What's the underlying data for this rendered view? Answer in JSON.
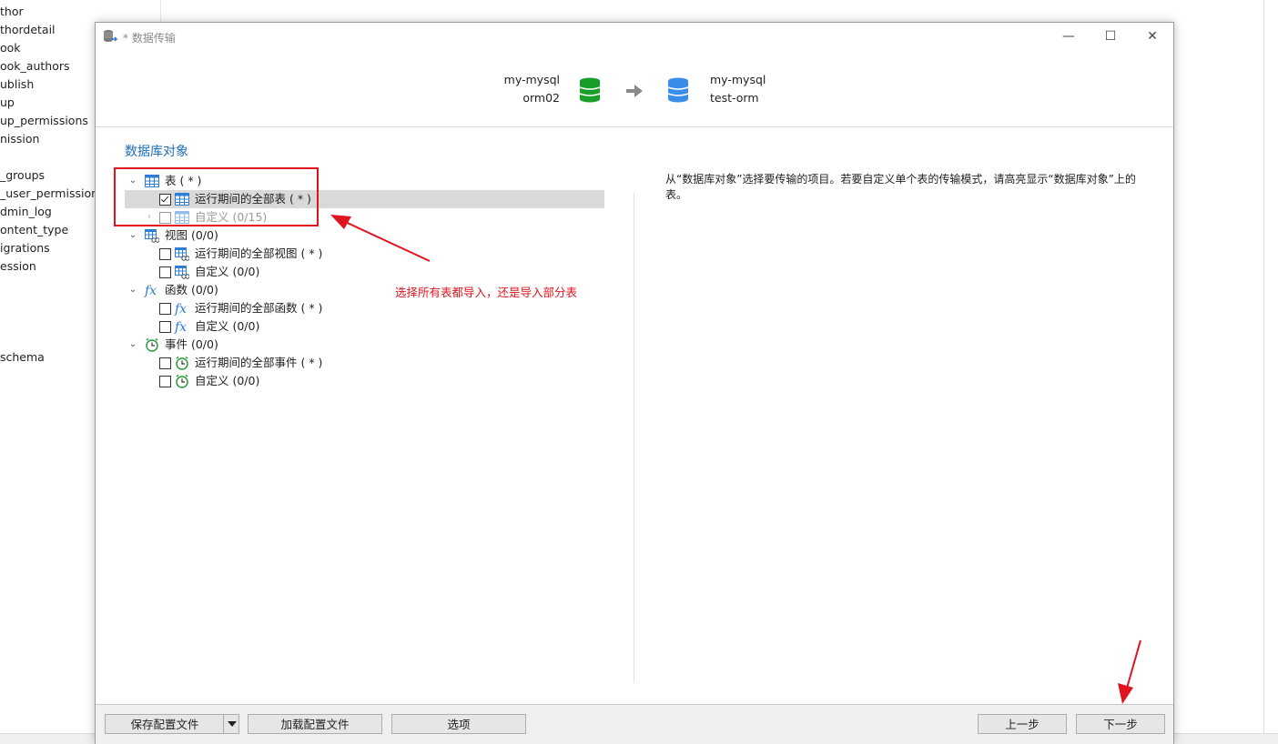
{
  "background": {
    "sidebar_items": [
      "thor",
      "thordetail",
      "ook",
      "ook_authors",
      "ublish",
      "up",
      "up_permissions",
      "nission",
      "_groups",
      "_user_permissions",
      "dmin_log",
      "ontent_type",
      "igrations",
      "ession",
      "schema"
    ]
  },
  "dialog": {
    "title": "* 数据传输",
    "window_controls": {
      "minimize": "—",
      "maximize": "☐",
      "close": "✕"
    },
    "source": {
      "connection": "my-mysql",
      "database": "orm02",
      "color": "#1a9e2a"
    },
    "target": {
      "connection": "my-mysql",
      "database": "test-orm",
      "color": "#3b8ee8"
    },
    "section_title": "数据库对象",
    "tree": {
      "tables": {
        "label": "表 ( * )",
        "all_runtime": "运行期间的全部表 ( * )",
        "custom": "自定义 (0/15)"
      },
      "views": {
        "label": "视图 (0/0)",
        "all_runtime": "运行期间的全部视图 ( * )",
        "custom": "自定义 (0/0)"
      },
      "functions": {
        "label": "函数 (0/0)",
        "all_runtime": "运行期间的全部函数 ( * )",
        "custom": "自定义 (0/0)"
      },
      "events": {
        "label": "事件 (0/0)",
        "all_runtime": "运行期间的全部事件 ( * )",
        "custom": "自定义 (0/0)"
      }
    },
    "description": "从“数据库对象”选择要传输的项目。若要自定义单个表的传输模式，请高亮显示“数据库对象”上的表。",
    "annotation": "选择所有表都导入，还是导入部分表",
    "footer": {
      "save_profile": "保存配置文件",
      "load_profile": "加载配置文件",
      "options": "选项",
      "back": "上一步",
      "next": "下一步"
    }
  }
}
